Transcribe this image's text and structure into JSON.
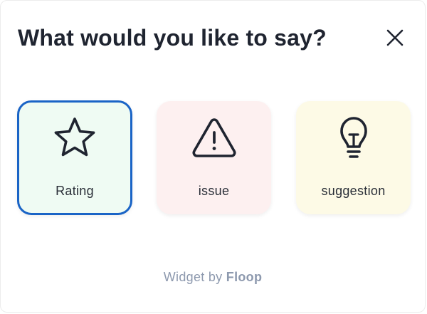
{
  "header": {
    "title": "What would you like to say?",
    "close_icon": "close-icon"
  },
  "options": [
    {
      "id": "rating",
      "label": "Rating",
      "icon": "star-icon",
      "background": "#effbf3",
      "selected": true,
      "border_color": "#1a64c6"
    },
    {
      "id": "issue",
      "label": "issue",
      "icon": "warning-triangle-icon",
      "background": "#fdf0f0",
      "selected": false
    },
    {
      "id": "suggestion",
      "label": "suggestion",
      "icon": "lightbulb-icon",
      "background": "#fdfae6",
      "selected": false
    }
  ],
  "footer": {
    "prefix": "Widget by",
    "brand": "Floop"
  },
  "colors": {
    "title": "#1f2430",
    "footer_text": "#8d99ae",
    "selection_border": "#1a64c6"
  }
}
